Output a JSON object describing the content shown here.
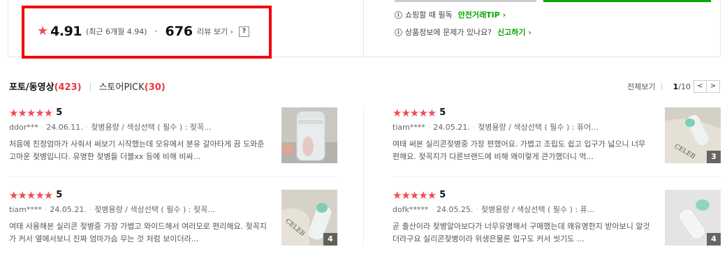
{
  "summary": {
    "rating_score": "4.91",
    "rating_recent": "(최근 6개월 4.94)",
    "review_count": "676",
    "review_link": "리뷰 보기",
    "help_button": "?"
  },
  "info": [
    {
      "text": "쇼핑할 때 필독",
      "link": "안전거래TIP"
    },
    {
      "text": "상품정보에 문제가 있나요?",
      "link": "신고하기"
    }
  ],
  "tabs": [
    {
      "label": "포토/동영상",
      "count": "(423)"
    },
    {
      "label": "스토어PICK",
      "count": "(30)"
    }
  ],
  "pager": {
    "view_all": "전체보기",
    "current": "1",
    "total": "/10",
    "prev": "<",
    "next": ">"
  },
  "reviews": [
    {
      "score": "5",
      "user": "ddor***",
      "date": "24.06.11.",
      "option": "젖병용량 / 색상선택 ( 필수 ) : 젖꼭...",
      "text": "처음에 친정엄마가 사줘서 써보기 시작했는데 모유에서 분유 갈아타게 끔 도와준 고마운 젖병입니다. 유명한 젖병들 더블xx 등에 비해 비싸...",
      "photo_count": ""
    },
    {
      "score": "5",
      "user": "tiam****",
      "date": "24.05.21.",
      "option": "젖병용량 / 색상선택 ( 필수 ) : 퓨어...",
      "text": "여태 써본 실리콘젖병중 가장 편했어요. 가볍고 조립도 쉽고 입구가 넓으니 너무 편해요. 젖꼭지가 다른브랜드에 비해 왜이렇게 큰가했더니 먹...",
      "photo_count": "3"
    },
    {
      "score": "5",
      "user": "tiam****",
      "date": "24.05.21.",
      "option": "젖병용량 / 색상선택 ( 필수 ) : 젖꼭...",
      "text": "여태 사용해본 실리콘 젖병중 가장 가볍고 와이드해서 여러모로 편리해요. 젖꼭지가 커서 옆에서보니 진짜 엄마가슴 무는 것 처럼 보이더라...",
      "photo_count": "4"
    },
    {
      "score": "5",
      "user": "dofk*****",
      "date": "24.05.25.",
      "option": "젖병용량 / 색상선택 ( 필수 ) : 퓨...",
      "text": "곧 출산이라 젖병알아보다가 너무유명해서 구매했는데 왜유명한지 받아보니 알것더라구요 실리콘젖병이라 위생은물론 입구도 커서 씻기도 ...",
      "photo_count": "4"
    }
  ]
}
